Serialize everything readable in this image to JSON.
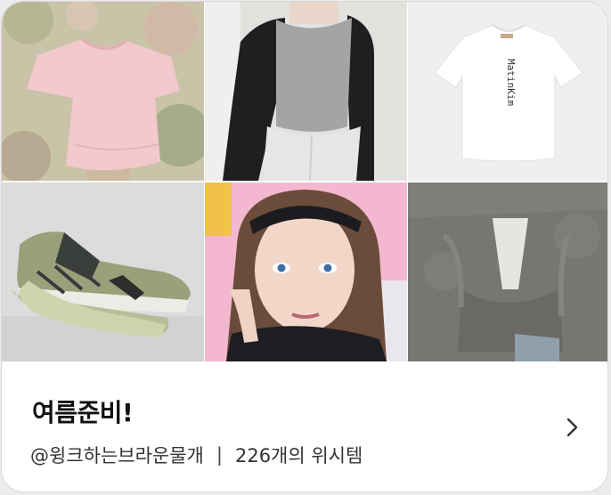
{
  "wishlist": {
    "title": "여름준비!",
    "owner": "@윙크하는브라운물개",
    "separator": "|",
    "count_text": "226개의 위시템"
  },
  "tiles": [
    {
      "name": "pink-knit-top-image"
    },
    {
      "name": "gray-raglan-top-image"
    },
    {
      "name": "white-tshirt-image",
      "print": "MatinKim"
    },
    {
      "name": "sneakers-image"
    },
    {
      "name": "model-headband-image"
    },
    {
      "name": "gray-fuzzy-cardigan-image"
    }
  ],
  "colors": {
    "title": "#111111",
    "meta": "#333333",
    "border": "#d9d9d9"
  },
  "icons": {
    "chevron": "chevron-right-icon"
  }
}
